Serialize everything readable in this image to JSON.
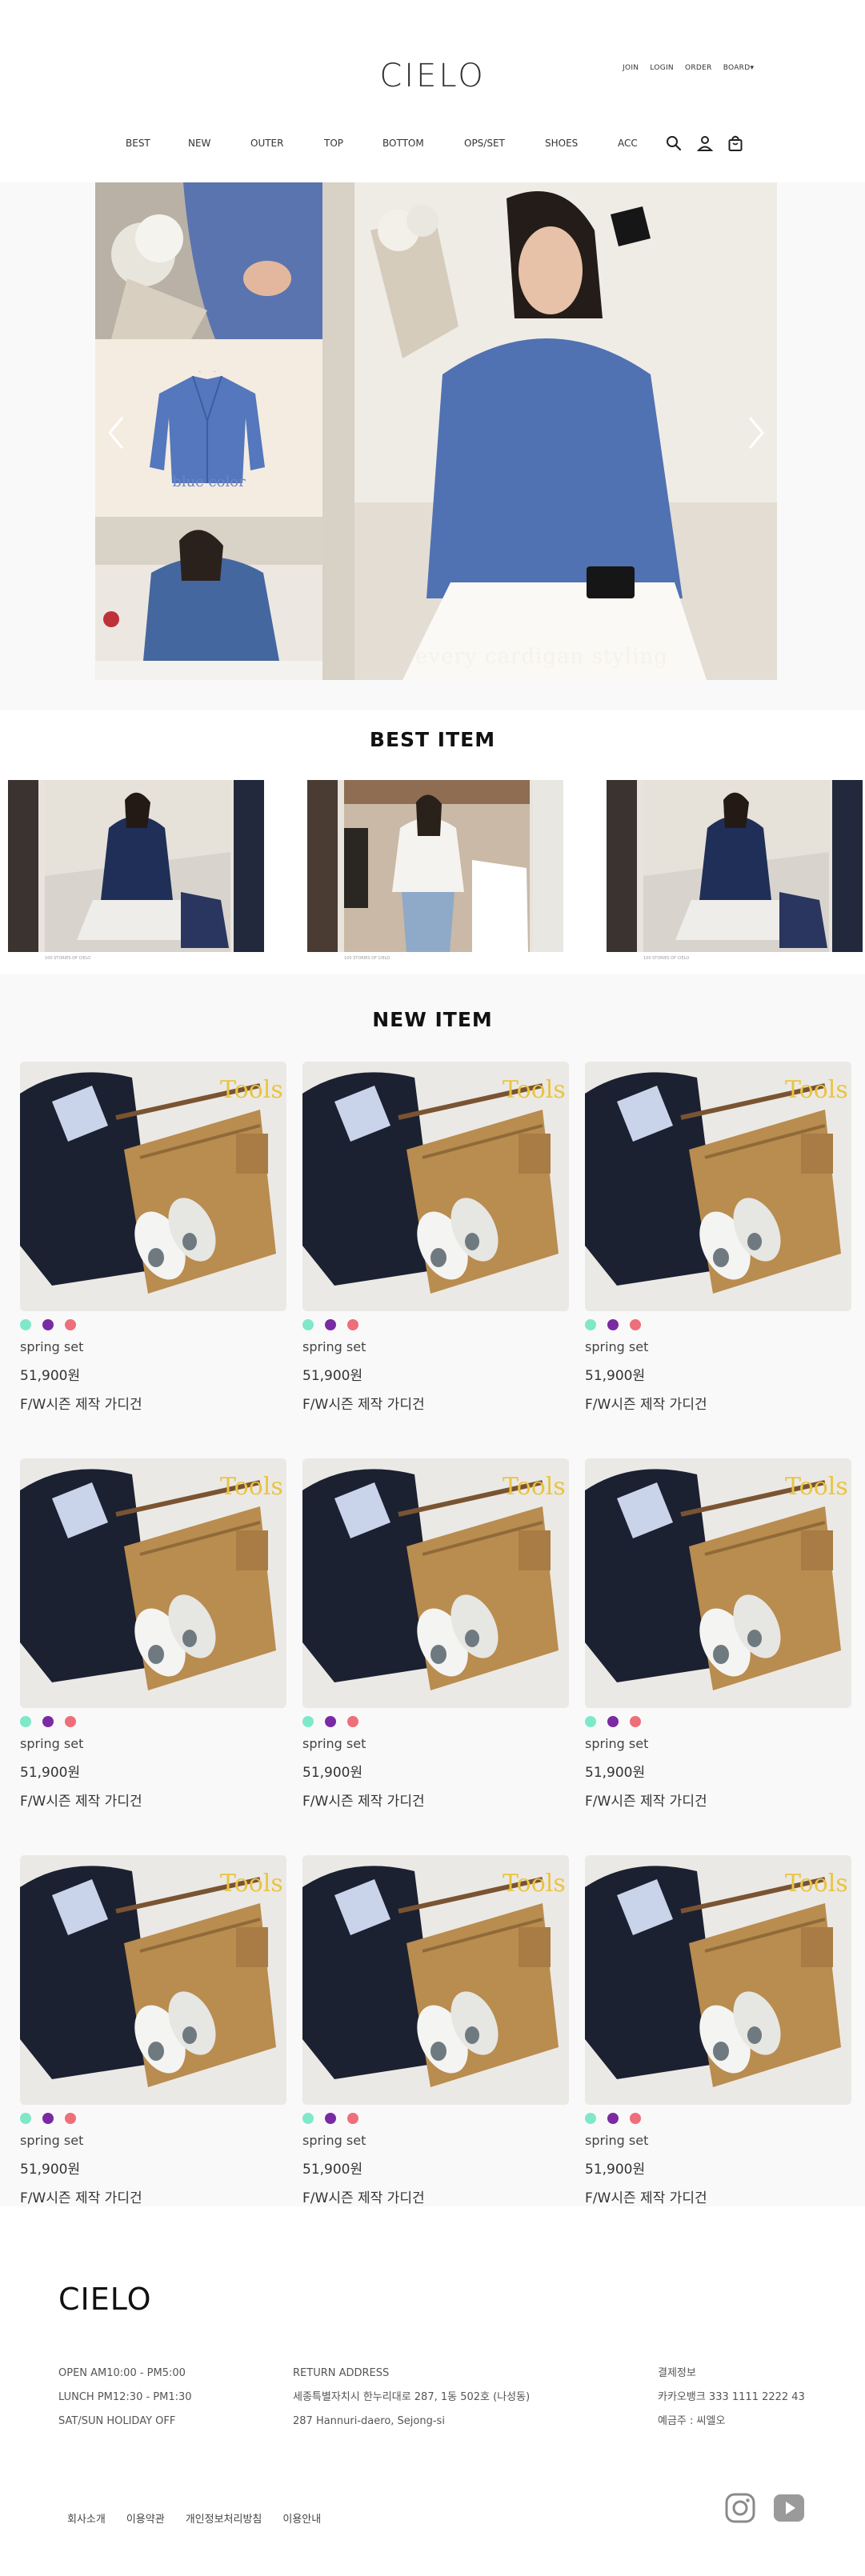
{
  "header": {
    "logo": "CIELO",
    "util": [
      "JOIN",
      "LOGIN",
      "ORDER",
      "BOARD"
    ],
    "menu": [
      "BEST",
      "NEW",
      "OUTER",
      "TOP",
      "BOTTOM",
      "OPS/SET",
      "SHOES",
      "ACC"
    ],
    "icons": [
      "search-icon",
      "user-icon",
      "shopping-bag-icon"
    ]
  },
  "hero": {
    "blue_label": "blue color",
    "caption": "every cardigan styling"
  },
  "best": {
    "title": "BEST ITEM",
    "slides": [
      {
        "foot": "100 STORIES OF CIELO"
      },
      {
        "foot": "100 STORIES OF CIELO"
      },
      {
        "foot": "100 STORIES OF CIELO"
      }
    ]
  },
  "new": {
    "title": "NEW ITEM",
    "colors": [
      "#7fe8c9",
      "#7a2aa3",
      "#ee6e7a"
    ],
    "products": [
      {
        "name": "spring set",
        "price": "51,900원",
        "desc": "F/W시즌 제작 가디건"
      },
      {
        "name": "spring set",
        "price": "51,900원",
        "desc": "F/W시즌 제작 가디건"
      },
      {
        "name": "spring set",
        "price": "51,900원",
        "desc": "F/W시즌 제작 가디건"
      },
      {
        "name": "spring set",
        "price": "51,900원",
        "desc": "F/W시즌 제작 가디건"
      },
      {
        "name": "spring set",
        "price": "51,900원",
        "desc": "F/W시즌 제작 가디건"
      },
      {
        "name": "spring set",
        "price": "51,900원",
        "desc": "F/W시즌 제작 가디건"
      },
      {
        "name": "spring set",
        "price": "51,900원",
        "desc": "F/W시즌 제작 가디건"
      },
      {
        "name": "spring set",
        "price": "51,900원",
        "desc": "F/W시즌 제작 가디건"
      },
      {
        "name": "spring set",
        "price": "51,900원",
        "desc": "F/W시즌 제작 가디건"
      }
    ]
  },
  "footer": {
    "logo": "CIELO",
    "hours": [
      "OPEN AM10:00 - PM5:00",
      "LUNCH PM12:30 - PM1:30",
      "SAT/SUN HOLIDAY OFF"
    ],
    "address": [
      "RETURN ADDRESS",
      "세종특별자치시 한누리대로 287, 1동 502호 (나성동)",
      "287 Hannuri-daero, Sejong-si"
    ],
    "payment": [
      "결제정보",
      "카카오뱅크 333 1111 2222 43",
      "예금주 : 씨엘오"
    ],
    "links": [
      "회사소개",
      "이용약관",
      "개인정보처리방침",
      "이용안내"
    ]
  }
}
